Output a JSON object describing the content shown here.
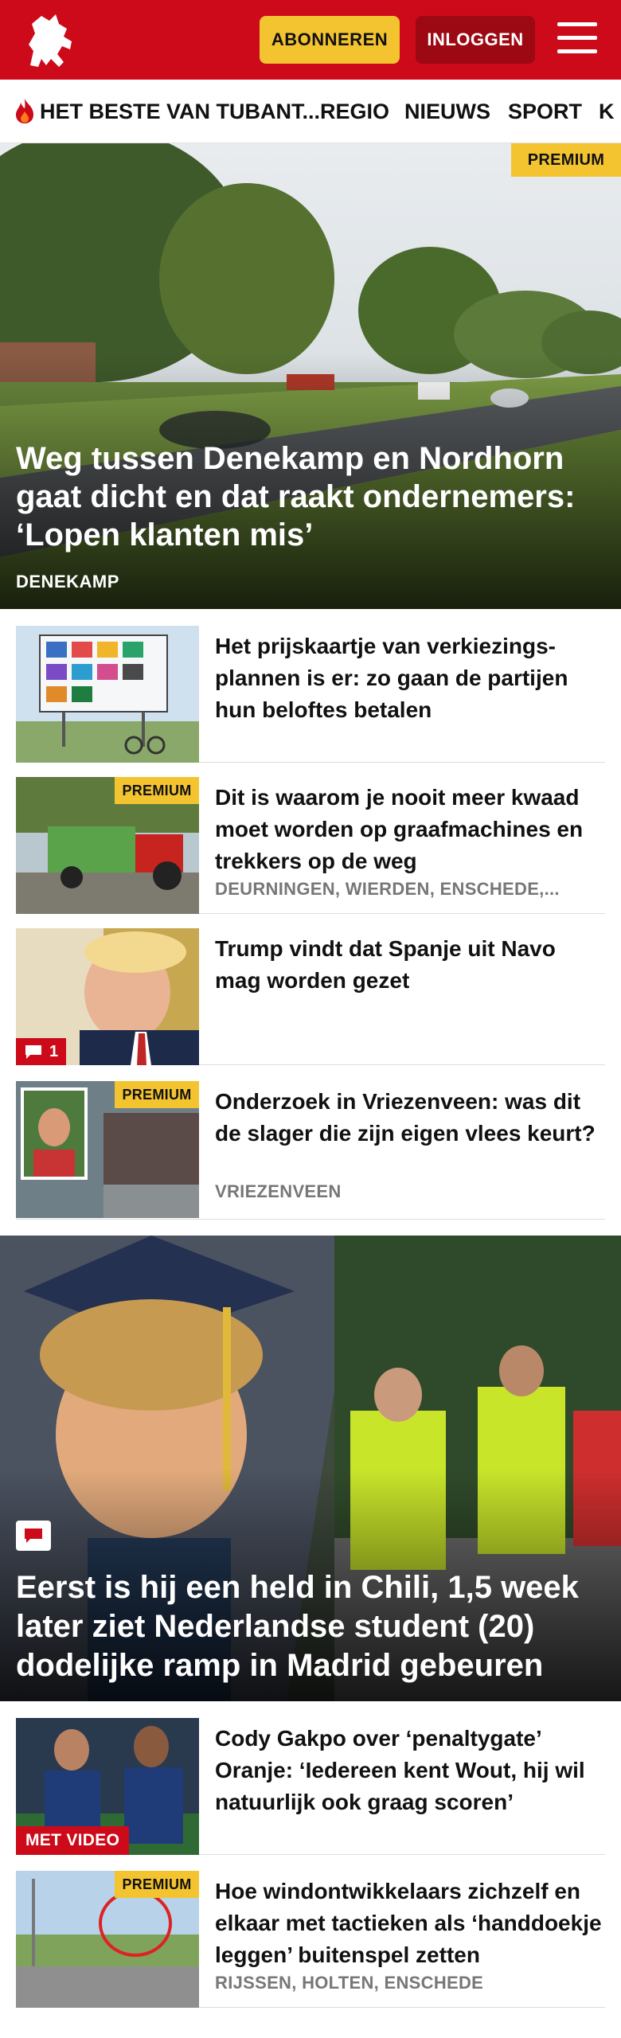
{
  "header": {
    "logo_icon": "horse-logo-icon",
    "subscribe_label": "ABONNEREN",
    "login_label": "INLOGGEN",
    "menu_icon": "hamburger-menu-icon",
    "brand_color": "#cc0a1a",
    "accent_color": "#f4c430"
  },
  "nav": {
    "items": [
      {
        "label": "HET BESTE VAN TUBANT...",
        "icon": "flame-icon"
      },
      {
        "label": "REGIO"
      },
      {
        "label": "NIEUWS"
      },
      {
        "label": "SPORT"
      },
      {
        "label": "K"
      }
    ]
  },
  "hero": {
    "badge": "PREMIUM",
    "title": "Weg tussen Denekamp en Nordhorn gaat dicht en dat raakt ondernemers: ‘Lopen klanten mis’",
    "kicker": "DENEKAMP"
  },
  "articles": [
    {
      "title": "Het prijskaartje van verkiezings­plannen is er: zo gaan de partijen hun beloftes betalen",
      "meta": "",
      "badge": ""
    },
    {
      "title": "Dit is waarom je nooit meer kwaad moet worden op graafmachines en trekkers op de weg",
      "meta": "DEURNINGEN, WIERDEN, ENSCHEDE,...",
      "badge": "PREMIUM"
    },
    {
      "title": "Trump vindt dat Spanje uit Navo mag worden gezet",
      "meta": "",
      "badge": "",
      "comment_count": "1"
    },
    {
      "title": "Onderzoek in Vriezenveen: was dit de slager die zijn eigen vlees keurt?",
      "meta": "VRIEZENVEEN",
      "badge": "PREMIUM"
    }
  ],
  "hero2": {
    "title": "Eerst is hij een held in Chili, 1,5 week later ziet Nederlandse student (20) dodelijke ramp in Madrid gebeuren",
    "comment_icon": "comment-icon"
  },
  "articles2": [
    {
      "title": "Cody Gakpo over ‘penaltygate’ Oranje: ‘Iedereen kent Wout, hij wil natuurlijk ook graag scoren’",
      "meta": "",
      "video_label": "MET VIDEO"
    },
    {
      "title": "Hoe windontwikkelaars zichzelf en elkaar met tactieken als ‘handdoekje leggen’ buitenspel zetten",
      "meta": "RIJSSEN, HOLTEN, ENSCHEDE",
      "badge": "PREMIUM"
    }
  ]
}
